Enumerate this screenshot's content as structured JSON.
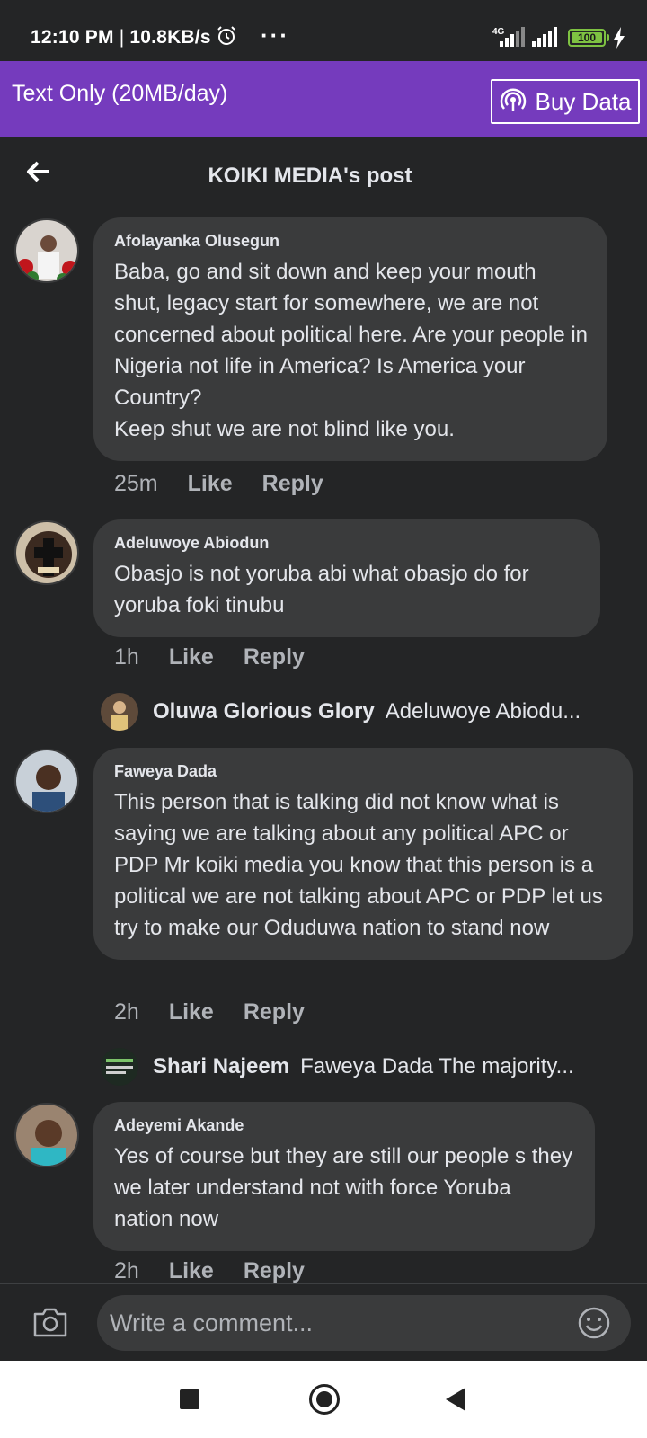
{
  "status_bar": {
    "time": "12:10 PM",
    "speed": "10.8KB/s",
    "network": "4G",
    "battery": "100",
    "icons": [
      "alarm-icon",
      "more-dots-icon",
      "signal-icon",
      "battery-icon",
      "charging-icon"
    ]
  },
  "banner": {
    "mode_text": "Text Only (20MB/day)",
    "buy_label": "Buy Data",
    "background": "#753bbd"
  },
  "header": {
    "title": "KOIKI MEDIA's post"
  },
  "comments": [
    {
      "author": "Afolayanka Olusegun",
      "text": "Baba, go and sit down and keep your mouth shut, legacy start for somewhere, we are not concerned about political here. Are your people in Nigeria not life in America? Is America your Country?\nKeep shut we are not blind like you.",
      "time": "25m",
      "like": "Like",
      "reply": "Reply"
    },
    {
      "author": "Adeluwoye Abiodun",
      "text": "Obasjo is not yoruba abi what obasjo do for yoruba foki tinubu",
      "time": "1h",
      "like": "Like",
      "reply": "Reply",
      "reply_preview": {
        "name": "Oluwa Glorious Glory",
        "snippet": "Adeluwoye Abiodu..."
      }
    },
    {
      "author": "Faweya Dada",
      "text": "This person that is talking did not know what is saying we are talking about any political APC or PDP  Mr koiki media you know that this person is a political we are not talking about APC or PDP let us try to make our Oduduwa nation to stand now",
      "time": "2h",
      "like": "Like",
      "reply": "Reply",
      "reply_preview": {
        "name": "Shari Najeem",
        "snippet": "Faweya Dada The majority..."
      }
    },
    {
      "author": "Adeyemi Akande",
      "text": "Yes of course but they are still our people s they we later understand not with force Yoruba nation now",
      "time": "2h",
      "like": "Like",
      "reply": "Reply"
    }
  ],
  "composer": {
    "placeholder": "Write a comment..."
  }
}
